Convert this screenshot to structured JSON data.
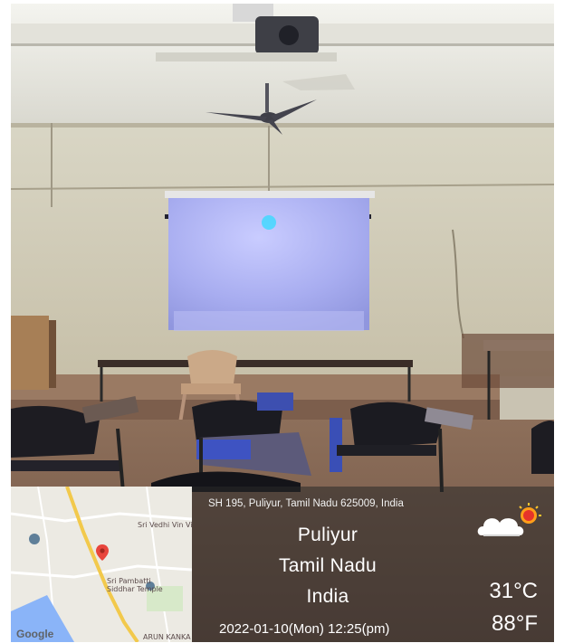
{
  "geotag": {
    "address": "SH 195, Puliyur, Tamil Nadu 625009, India",
    "city": "Puliyur",
    "state": "Tamil Nadu",
    "country": "India",
    "datetime": "2022-01-10(Mon)   12:25(pm)",
    "temp_c": "31°C",
    "temp_f": "88°F",
    "weather_icon": "partly-cloudy-icon"
  },
  "map": {
    "brand": "Google",
    "labels": {
      "top": "Sri Vedhi Vin Vinayagar Temp",
      "temple": "Sri Pambatti Siddhar Temple",
      "road": "ARUN KANKA"
    },
    "pin_color": "#e8453c",
    "road_color": "#f2c94c",
    "water_color": "#8ab4f8"
  }
}
